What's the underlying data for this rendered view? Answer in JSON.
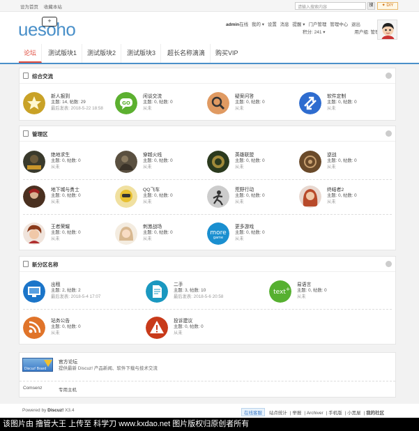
{
  "topbar": {
    "set_home": "设为首页",
    "bookmark": "收藏本站",
    "search_placeholder": "请输入搜索内容",
    "search_btn": "搜",
    "diy": "✦ DIY"
  },
  "header": {
    "logo_text": "uesoho",
    "logo_badge": "+",
    "username": "admin",
    "online": "在线",
    "menu": [
      "我的 ▾",
      "设置",
      "消息",
      "提醒 ▾",
      "门户管理",
      "管理中心",
      "退出"
    ],
    "points": "积分: 241 ▾",
    "user_group": "用户组: 管理员 ▾"
  },
  "nav": {
    "items": [
      "论坛",
      "测试版块1",
      "测试版块2",
      "测试版块3",
      "超长名称滴滴",
      "购买VIP"
    ]
  },
  "sections": [
    {
      "title": "综合交流",
      "forums": [
        {
          "name": "新人报到",
          "stats": "主题: 14, 帖数: 29",
          "last": "最后发表: 2018-5-22 18:58",
          "icon": "star-icon",
          "color": "#c9a227"
        },
        {
          "name": "闲谈交流",
          "stats": "主题: 0, 帖数: 0",
          "last": "从未",
          "icon": "chat-go-icon",
          "color": "#5cb030"
        },
        {
          "name": "疑案问答",
          "stats": "主题: 0, 帖数: 0",
          "last": "从未",
          "icon": "magnifier-icon",
          "color": "#e09a62"
        },
        {
          "name": "软件定制",
          "stats": "主题: 0, 帖数: 0",
          "last": "从未",
          "icon": "arrows-icon",
          "color": "#2e6ccf"
        }
      ]
    },
    {
      "title": "管理区",
      "forums": [
        {
          "name": "绝地求生",
          "stats": "主题: 0, 帖数: 0",
          "last": "从未",
          "icon": "pubg-icon",
          "color": "#3a3a2c"
        },
        {
          "name": "穿越火线",
          "stats": "主题: 0, 帖数: 0",
          "last": "从未",
          "icon": "soldier-icon",
          "color": "#5a5040"
        },
        {
          "name": "英雄联盟",
          "stats": "主题: 0, 帖数: 0",
          "last": "从未",
          "icon": "lol-icon",
          "color": "#2b3a1e"
        },
        {
          "name": "逆战",
          "stats": "主题: 0, 帖数: 0",
          "last": "从未",
          "icon": "mech-icon",
          "color": "#6a4a2a"
        },
        {
          "name": "地下城与勇士",
          "stats": "主题: 0, 帖数: 0",
          "last": "从未",
          "icon": "dnf-icon",
          "color": "#4a3020"
        },
        {
          "name": "QQ飞车",
          "stats": "主题: 0, 帖数: 0",
          "last": "从未",
          "icon": "racer-icon",
          "color": "#e8c030"
        },
        {
          "name": "荒野行动",
          "stats": "主题: 0, 帖数: 0",
          "last": "从未",
          "icon": "runner-icon",
          "color": "#888888"
        },
        {
          "name": "终结者2",
          "stats": "主题: 0, 帖数: 0",
          "last": "从未",
          "icon": "heroine-icon",
          "color": "#c87a5a"
        },
        {
          "name": "王者荣耀",
          "stats": "主题: 0, 帖数: 0",
          "last": "从未",
          "icon": "hero-icon",
          "color": "#b05a3a"
        },
        {
          "name": "刺激战场",
          "stats": "主题: 0, 帖数: 0",
          "last": "从未",
          "icon": "girl-icon",
          "color": "#d8b890"
        },
        {
          "name": "更多游戏",
          "stats": "主题: 0, 帖数: 0",
          "last": "从未",
          "icon": "more-game-icon",
          "color": "#1a8fd0"
        }
      ]
    },
    {
      "title": "新分区名称",
      "forums": [
        {
          "name": "出租",
          "stats": "主题: 2, 帖数: 2",
          "last": "最后发表: 2018-5-4 17:07",
          "icon": "monitor-icon",
          "color": "#1b75c9"
        },
        {
          "name": "二手",
          "stats": "主题: 3, 帖数: 10",
          "last": "最后发表: 2018-5-6 20:58",
          "icon": "document-icon",
          "color": "#1a98c0"
        },
        {
          "name": "易语言",
          "stats": "主题: 0, 帖数: 0",
          "last": "从未",
          "icon": "text-plus-icon",
          "color": "#56b030"
        },
        {
          "name": "站务公告",
          "stats": "主题: 0, 帖数: 0",
          "last": "从未",
          "icon": "rss-icon",
          "color": "#e0742a"
        },
        {
          "name": "投诉建议",
          "stats": "主题: 0, 帖数: 0",
          "last": "从未",
          "icon": "warning-icon",
          "color": "#c83a1a"
        }
      ]
    }
  ],
  "links": {
    "official_title": "官方论坛",
    "official_desc": "提供最新 Discuz! 产品新闻、软件下载与技术交流",
    "banner_text": "Discuz! Board",
    "comsenz": "Comsenz",
    "host": "专用主机"
  },
  "footer": {
    "powered": "Powered by",
    "discuz": "Discuz!",
    "version": "X3.4",
    "service": "在线客服",
    "links": [
      "站点统计",
      "举报",
      "Archiver",
      "手机版",
      "小黑屋",
      "我的社区"
    ]
  },
  "watermark": "该图片由 撸管大王 上传至 科学刀 www.kxdao.net 图片版权归原创者所有"
}
